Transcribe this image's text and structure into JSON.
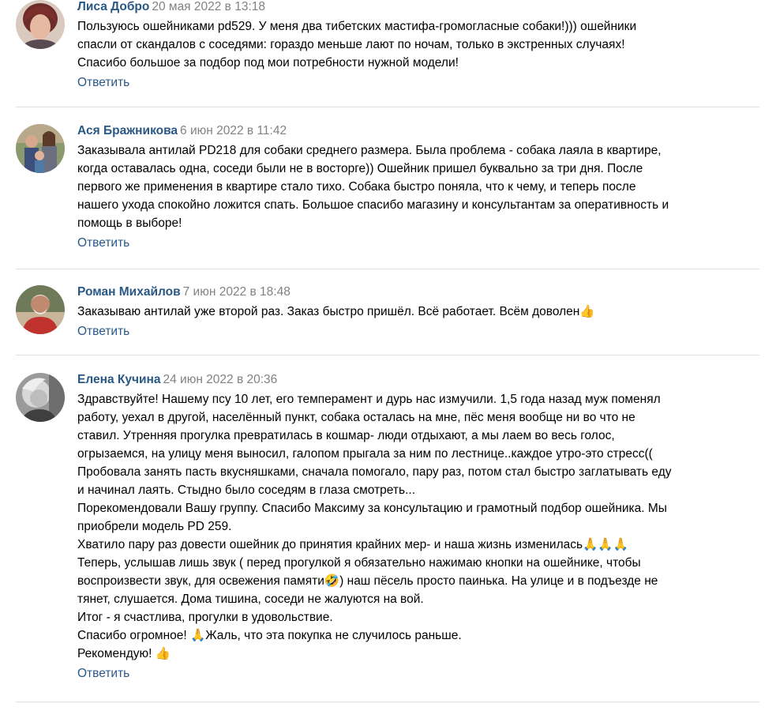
{
  "comments": [
    {
      "author": "Лиса Добро",
      "date": "20 мая 2022 в 13:18",
      "text": "Пользуюсь ошейниками pd529. У меня два тибетских мастифа-громогласные собаки!))) ошейники\nспасли от скандалов с соседями: гораздо меньше лают по ночам, только в экстренных случаях!\nСпасибо большое за подбор под мои потребности нужной модели!",
      "reply": "Ответить"
    },
    {
      "author": "Ася Бражникова",
      "date": "6 июн 2022 в 11:42",
      "text": "Заказывала антилай PD218 для собаки среднего размера. Была проблема - собака лаяла в квартире,\nкогда оставалась одна, соседи были не в восторге)) Ошейник пришел буквально за три дня. После\nпервого же применения в квартире стало тихо. Собака быстро поняла, что к чему, и теперь после\nнашего ухода спокойно ложится спать. Большое спасибо магазину и консультантам за оперативность и\nпомощь в выборе!",
      "reply": "Ответить"
    },
    {
      "author": "Роман Михайлов",
      "date": "7 июн 2022 в 18:48",
      "text": "Заказываю антилай уже второй раз. Заказ быстро пришёл. Всё работает. Всём доволен👍",
      "reply": "Ответить"
    },
    {
      "author": "Елена Кучина",
      "date": "24 июн 2022 в 20:36",
      "text": "Здравствуйте! Нашему псу 10 лет, его темперамент и дурь нас измучили. 1,5 года назад муж поменял\nработу, уехал в другой, населённый пункт, собака осталась на мне, пёс меня вообще ни во что не\nставил. Утренняя прогулка превратилась в кошмар- люди отдыхают, а мы лаем во весь голос,\nогрызаемся, на улицу меня выносил, галопом прыгала за ним по лестнице..каждое утро-это стресс((\nПробовала занять пасть вкусняшками, сначала помогало, пару раз, потом стал быстро заглатывать еду\nи начинал лаять. Стыдно было соседям в глаза смотреть...\nПорекомендовали Вашу группу. Спасибо Максиму за консультацию и грамотный подбор ошейника. Мы\nприобрели модель PD 259.\nХватило пару раз довести ошейник до принятия крайних мер- и наша жизнь изменилась🙏🙏🙏\nТеперь, услышав лишь звук ( перед прогулкой я обязательно нажимаю кнопки на ошейнике, чтобы\nвоспроизвести звук, для освежения памяти🤣) наш пёсель просто паинька. На улице и в подъезде не\nтянет, слушается. Дома тишина, соседи не жалуются на вой.\nИтог - я счастлива, прогулки в удовольствие.\nСпасибо огромное! 🙏Жаль, что эта покупка не случилось раньше.\nРекомендую! 👍",
      "reply": "Ответить"
    }
  ],
  "colors": {
    "link": "#2a5885",
    "date": "#828282",
    "divider": "#dce1e6"
  }
}
